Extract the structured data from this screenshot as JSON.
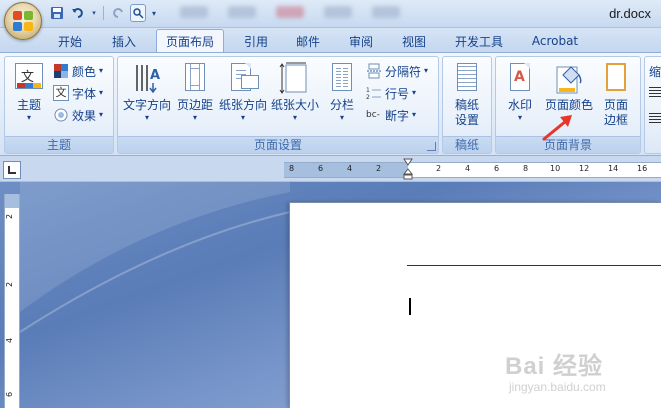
{
  "window": {
    "title": "dr.docx"
  },
  "tabs": [
    {
      "label": "开始"
    },
    {
      "label": "插入"
    },
    {
      "label": "页面布局",
      "active": true
    },
    {
      "label": "引用"
    },
    {
      "label": "邮件"
    },
    {
      "label": "审阅"
    },
    {
      "label": "视图"
    },
    {
      "label": "开发工具"
    },
    {
      "label": "Acrobat"
    }
  ],
  "ribbon": {
    "themes": {
      "group_label": "主题",
      "theme_btn": "主题",
      "colors": "颜色",
      "fonts": "字体",
      "effects": "效果",
      "theme_icon_text": "文"
    },
    "page_setup": {
      "group_label": "页面设置",
      "text_direction": "文字方向",
      "margins": "页边距",
      "orientation": "纸张方向",
      "size": "纸张大小",
      "columns": "分栏",
      "breaks": "分隔符",
      "line_numbers": "行号",
      "hyphenation": "断字"
    },
    "manuscript": {
      "group_label": "稿纸",
      "settings_line1": "稿纸",
      "settings_line2": "设置"
    },
    "page_background": {
      "group_label": "页面背景",
      "watermark": "水印",
      "page_color": "页面颜色",
      "borders_line1": "页面",
      "borders_line2": "边框"
    },
    "paragraph_partial": {
      "indent": "缩"
    }
  },
  "ruler": {
    "left_numbers": [
      "8",
      "6",
      "4",
      "2"
    ],
    "right_numbers": [
      "2",
      "4",
      "6",
      "8",
      "10",
      "12",
      "14",
      "16"
    ],
    "vertical_numbers": [
      "2",
      "2",
      "4",
      "6"
    ]
  },
  "watermark": {
    "main": "Bai 经验",
    "sub": "jingyan.baidu.com"
  },
  "colors": {
    "accent_arrow": "#e8362b",
    "ribbon_text": "#15428b"
  }
}
